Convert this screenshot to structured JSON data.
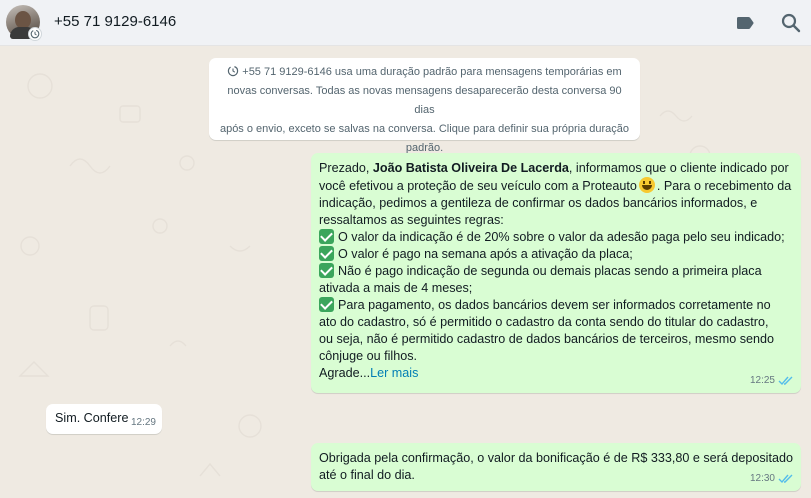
{
  "header": {
    "contact_name": "+55 71 9129-6146",
    "icons": [
      "label-icon",
      "search-icon"
    ]
  },
  "system_message": {
    "text": "+55 71 9129-6146 usa uma duração padrão para mensagens temporárias em novas conversas. Todas as novas mensagens desaparecerão desta conversa 90 dias após o envio, exceto se salvas na conversa. Clique para definir sua própria duração padrão.",
    "lines": [
      "+55 71 9129-6146 usa uma duração padrão para mensagens temporárias em",
      "novas conversas. Todas as novas mensagens desaparecerão desta conversa 90 dias",
      "após o envio, exceto se salvas na conversa. Clique para definir sua própria duração",
      "padrão."
    ]
  },
  "messages": {
    "m1": {
      "greeting": "Prezado, ",
      "name": "João Batista Oliveira De Lacerda",
      "after_name": ", informamos que o cliente indicado por",
      "line2": "você efetivou a proteção de seu veículo com a Proteauto",
      "line2_end": ". Para o recebimento da",
      "line3": "indicação, pedimos a gentileza de confirmar os dados bancários informados, e",
      "line4": "ressaltamos as seguintes regras:",
      "rule1": "O valor da indicação é de 20% sobre o valor da adesão paga pelo seu indicado;",
      "rule2": "O valor é pago na semana após a ativação da placa;",
      "rule3a": "Não é pago indicação de segunda ou demais placas sendo a primeira placa",
      "rule3b": "ativada a mais de 4 meses;",
      "rule4a": "Para pagamento, os dados bancários devem ser informados corretamente no",
      "rule4b": "ato do cadastro, só é permitido o cadastro da conta sendo do titular do cadastro,",
      "rule4c": "ou seja, não é permitido cadastro de dados bancários de terceiros, mesmo sendo",
      "rule4d": "cônjuge ou filhos.",
      "tail": "Agrade...",
      "read_more": "Ler mais",
      "time": "12:25",
      "status": "read"
    },
    "m2": {
      "text": "Sim. Confere",
      "time": "12:29"
    },
    "m3": {
      "line1": "Obrigada pela confirmação, o valor da bonificação é de R$ 333,80 e será depositado",
      "line2": "até o final do dia.",
      "time": "12:30",
      "status": "read"
    }
  },
  "colors": {
    "chat_bg": "#efeae2",
    "outgoing_bubble": "#d9fdd3",
    "incoming_bubble": "#ffffff",
    "read_ticks": "#53bdeb",
    "link": "#027eb5"
  }
}
